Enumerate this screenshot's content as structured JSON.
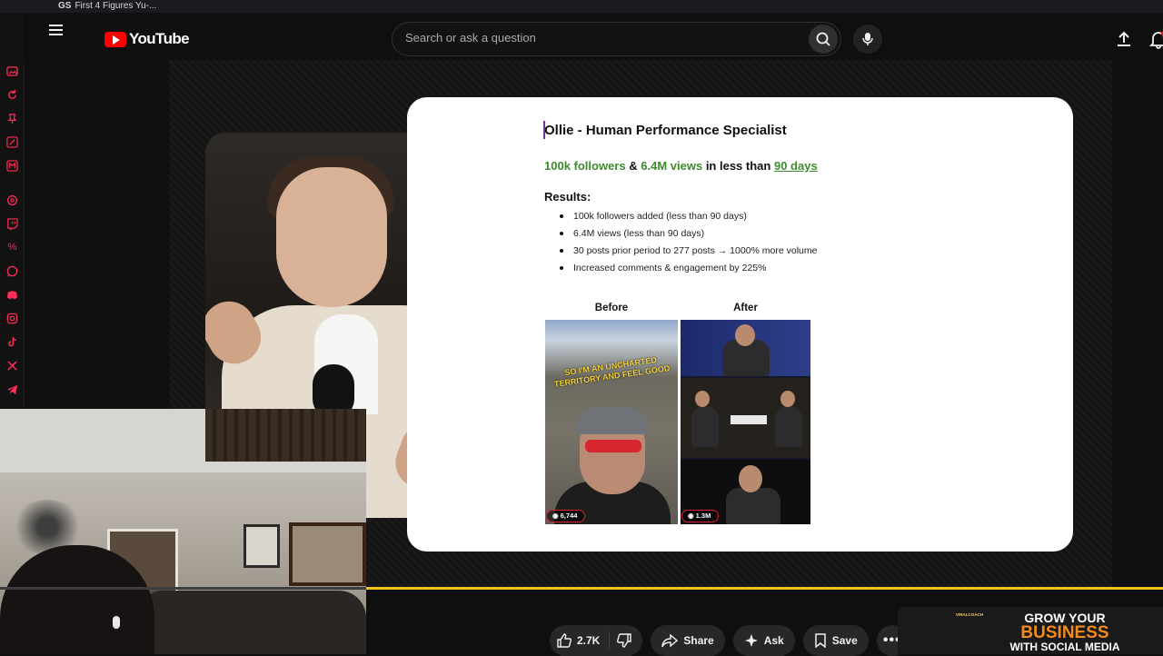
{
  "browser": {
    "tab_favicon_text": "GS",
    "tab_title": "First 4 Figures Yu-..."
  },
  "extensions": [
    "photo-icon",
    "refresh-icon",
    "pin-icon",
    "pen-icon",
    "m-icon",
    "threads-icon",
    "twitch-icon",
    "percent-icon",
    "whatsapp-icon",
    "discord-icon",
    "instagram-icon",
    "tiktok-icon",
    "x-icon",
    "telegram-icon"
  ],
  "header": {
    "logo_text": "YouTube",
    "search_placeholder": "Search or ask a question"
  },
  "slide": {
    "title": "Ollie - Human Performance Specialist",
    "stats": {
      "followers": "100k followers",
      "amp": "&",
      "views": "6.4M views",
      "middle": "in less than",
      "days": "90 days"
    },
    "results_label": "Results:",
    "results": [
      "100k followers added (less than 90 days)",
      "6.4M views (less than 90 days)",
      "30 posts prior period to 277 posts → 1000% more volume",
      "Increased comments & engagement by 225%"
    ],
    "before_label": "Before",
    "after_label": "After",
    "before_overlay": "SO I'M AN UNCHARTED TERRITORY AND FEEL GOOD",
    "before_views": "6,744",
    "after_views": "1.3M"
  },
  "actions": {
    "likes": "2.7K",
    "share": "Share",
    "ask": "Ask",
    "save": "Save"
  },
  "ad": {
    "brand": "VIRALCOACH",
    "line1": "GROW YOUR",
    "line2": "BUSINESS",
    "line3": "WITH SOCIAL MEDIA"
  },
  "colors": {
    "accent_red": "#ff0000",
    "extension_pink": "#ff2d55",
    "slide_green": "#3e8b2e",
    "progress_yellow": "#f0c419"
  }
}
